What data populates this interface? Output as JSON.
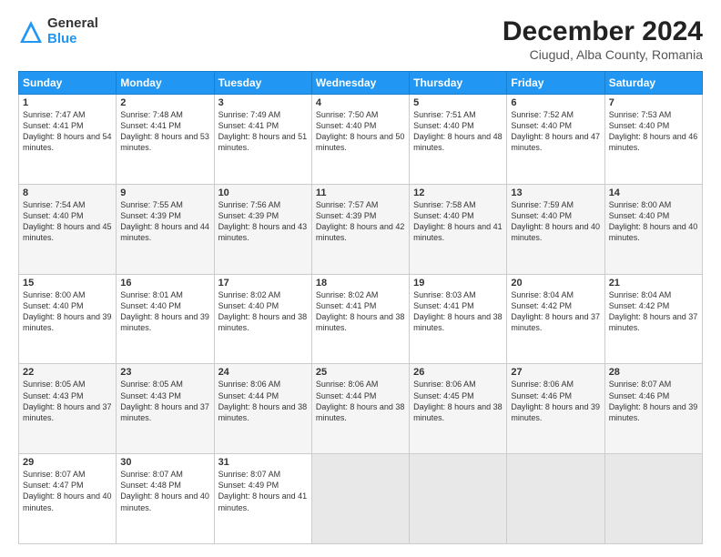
{
  "logo": {
    "line1": "General",
    "line2": "Blue"
  },
  "title": "December 2024",
  "subtitle": "Ciugud, Alba County, Romania",
  "days": [
    "Sunday",
    "Monday",
    "Tuesday",
    "Wednesday",
    "Thursday",
    "Friday",
    "Saturday"
  ],
  "weeks": [
    [
      {
        "day": "1",
        "sunrise": "7:47 AM",
        "sunset": "4:41 PM",
        "daylight": "8 hours and 54 minutes."
      },
      {
        "day": "2",
        "sunrise": "7:48 AM",
        "sunset": "4:41 PM",
        "daylight": "8 hours and 53 minutes."
      },
      {
        "day": "3",
        "sunrise": "7:49 AM",
        "sunset": "4:41 PM",
        "daylight": "8 hours and 51 minutes."
      },
      {
        "day": "4",
        "sunrise": "7:50 AM",
        "sunset": "4:40 PM",
        "daylight": "8 hours and 50 minutes."
      },
      {
        "day": "5",
        "sunrise": "7:51 AM",
        "sunset": "4:40 PM",
        "daylight": "8 hours and 48 minutes."
      },
      {
        "day": "6",
        "sunrise": "7:52 AM",
        "sunset": "4:40 PM",
        "daylight": "8 hours and 47 minutes."
      },
      {
        "day": "7",
        "sunrise": "7:53 AM",
        "sunset": "4:40 PM",
        "daylight": "8 hours and 46 minutes."
      }
    ],
    [
      {
        "day": "8",
        "sunrise": "7:54 AM",
        "sunset": "4:40 PM",
        "daylight": "8 hours and 45 minutes."
      },
      {
        "day": "9",
        "sunrise": "7:55 AM",
        "sunset": "4:39 PM",
        "daylight": "8 hours and 44 minutes."
      },
      {
        "day": "10",
        "sunrise": "7:56 AM",
        "sunset": "4:39 PM",
        "daylight": "8 hours and 43 minutes."
      },
      {
        "day": "11",
        "sunrise": "7:57 AM",
        "sunset": "4:39 PM",
        "daylight": "8 hours and 42 minutes."
      },
      {
        "day": "12",
        "sunrise": "7:58 AM",
        "sunset": "4:40 PM",
        "daylight": "8 hours and 41 minutes."
      },
      {
        "day": "13",
        "sunrise": "7:59 AM",
        "sunset": "4:40 PM",
        "daylight": "8 hours and 40 minutes."
      },
      {
        "day": "14",
        "sunrise": "8:00 AM",
        "sunset": "4:40 PM",
        "daylight": "8 hours and 40 minutes."
      }
    ],
    [
      {
        "day": "15",
        "sunrise": "8:00 AM",
        "sunset": "4:40 PM",
        "daylight": "8 hours and 39 minutes."
      },
      {
        "day": "16",
        "sunrise": "8:01 AM",
        "sunset": "4:40 PM",
        "daylight": "8 hours and 39 minutes."
      },
      {
        "day": "17",
        "sunrise": "8:02 AM",
        "sunset": "4:40 PM",
        "daylight": "8 hours and 38 minutes."
      },
      {
        "day": "18",
        "sunrise": "8:02 AM",
        "sunset": "4:41 PM",
        "daylight": "8 hours and 38 minutes."
      },
      {
        "day": "19",
        "sunrise": "8:03 AM",
        "sunset": "4:41 PM",
        "daylight": "8 hours and 38 minutes."
      },
      {
        "day": "20",
        "sunrise": "8:04 AM",
        "sunset": "4:42 PM",
        "daylight": "8 hours and 37 minutes."
      },
      {
        "day": "21",
        "sunrise": "8:04 AM",
        "sunset": "4:42 PM",
        "daylight": "8 hours and 37 minutes."
      }
    ],
    [
      {
        "day": "22",
        "sunrise": "8:05 AM",
        "sunset": "4:43 PM",
        "daylight": "8 hours and 37 minutes."
      },
      {
        "day": "23",
        "sunrise": "8:05 AM",
        "sunset": "4:43 PM",
        "daylight": "8 hours and 37 minutes."
      },
      {
        "day": "24",
        "sunrise": "8:06 AM",
        "sunset": "4:44 PM",
        "daylight": "8 hours and 38 minutes."
      },
      {
        "day": "25",
        "sunrise": "8:06 AM",
        "sunset": "4:44 PM",
        "daylight": "8 hours and 38 minutes."
      },
      {
        "day": "26",
        "sunrise": "8:06 AM",
        "sunset": "4:45 PM",
        "daylight": "8 hours and 38 minutes."
      },
      {
        "day": "27",
        "sunrise": "8:06 AM",
        "sunset": "4:46 PM",
        "daylight": "8 hours and 39 minutes."
      },
      {
        "day": "28",
        "sunrise": "8:07 AM",
        "sunset": "4:46 PM",
        "daylight": "8 hours and 39 minutes."
      }
    ],
    [
      {
        "day": "29",
        "sunrise": "8:07 AM",
        "sunset": "4:47 PM",
        "daylight": "8 hours and 40 minutes."
      },
      {
        "day": "30",
        "sunrise": "8:07 AM",
        "sunset": "4:48 PM",
        "daylight": "8 hours and 40 minutes."
      },
      {
        "day": "31",
        "sunrise": "8:07 AM",
        "sunset": "4:49 PM",
        "daylight": "8 hours and 41 minutes."
      },
      null,
      null,
      null,
      null
    ]
  ]
}
